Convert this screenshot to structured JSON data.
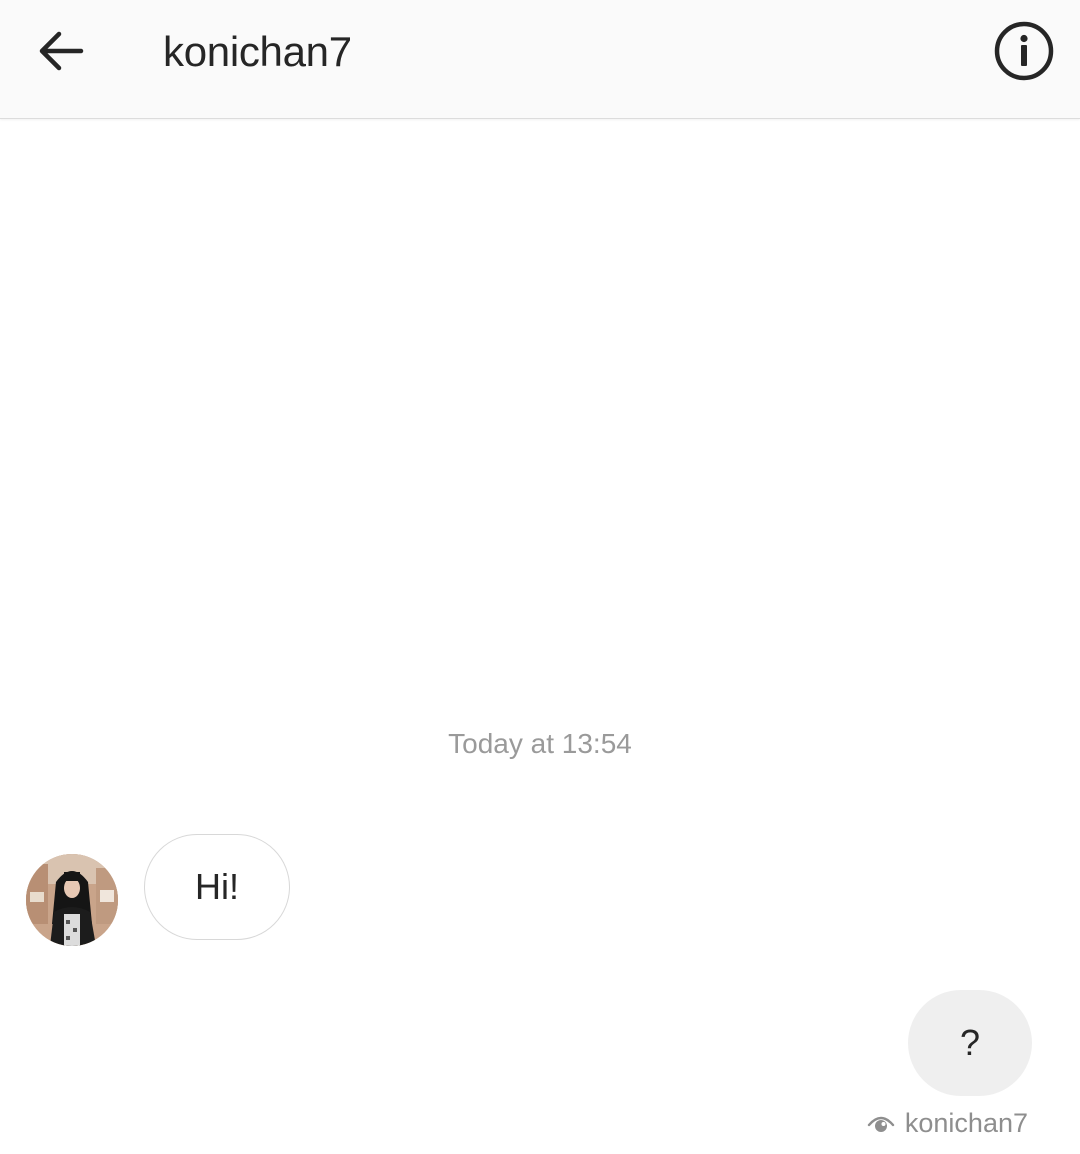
{
  "header": {
    "back_icon": "arrow-left-icon",
    "title": "konichan7",
    "info_icon": "info-circle-icon"
  },
  "conversation": {
    "timestamp": "Today at 13:54",
    "messages": [
      {
        "direction": "incoming",
        "sender_avatar": "avatar-photo",
        "text": "Hi!"
      },
      {
        "direction": "outgoing",
        "text": "?"
      }
    ],
    "seen": {
      "icon": "eye-icon",
      "by": "konichan7"
    }
  },
  "colors": {
    "header_bg": "#fafafa",
    "text_primary": "#262626",
    "text_secondary": "#9a9a9a",
    "outgoing_bubble": "#efefef",
    "incoming_bubble_border": "#d8d8d8"
  }
}
